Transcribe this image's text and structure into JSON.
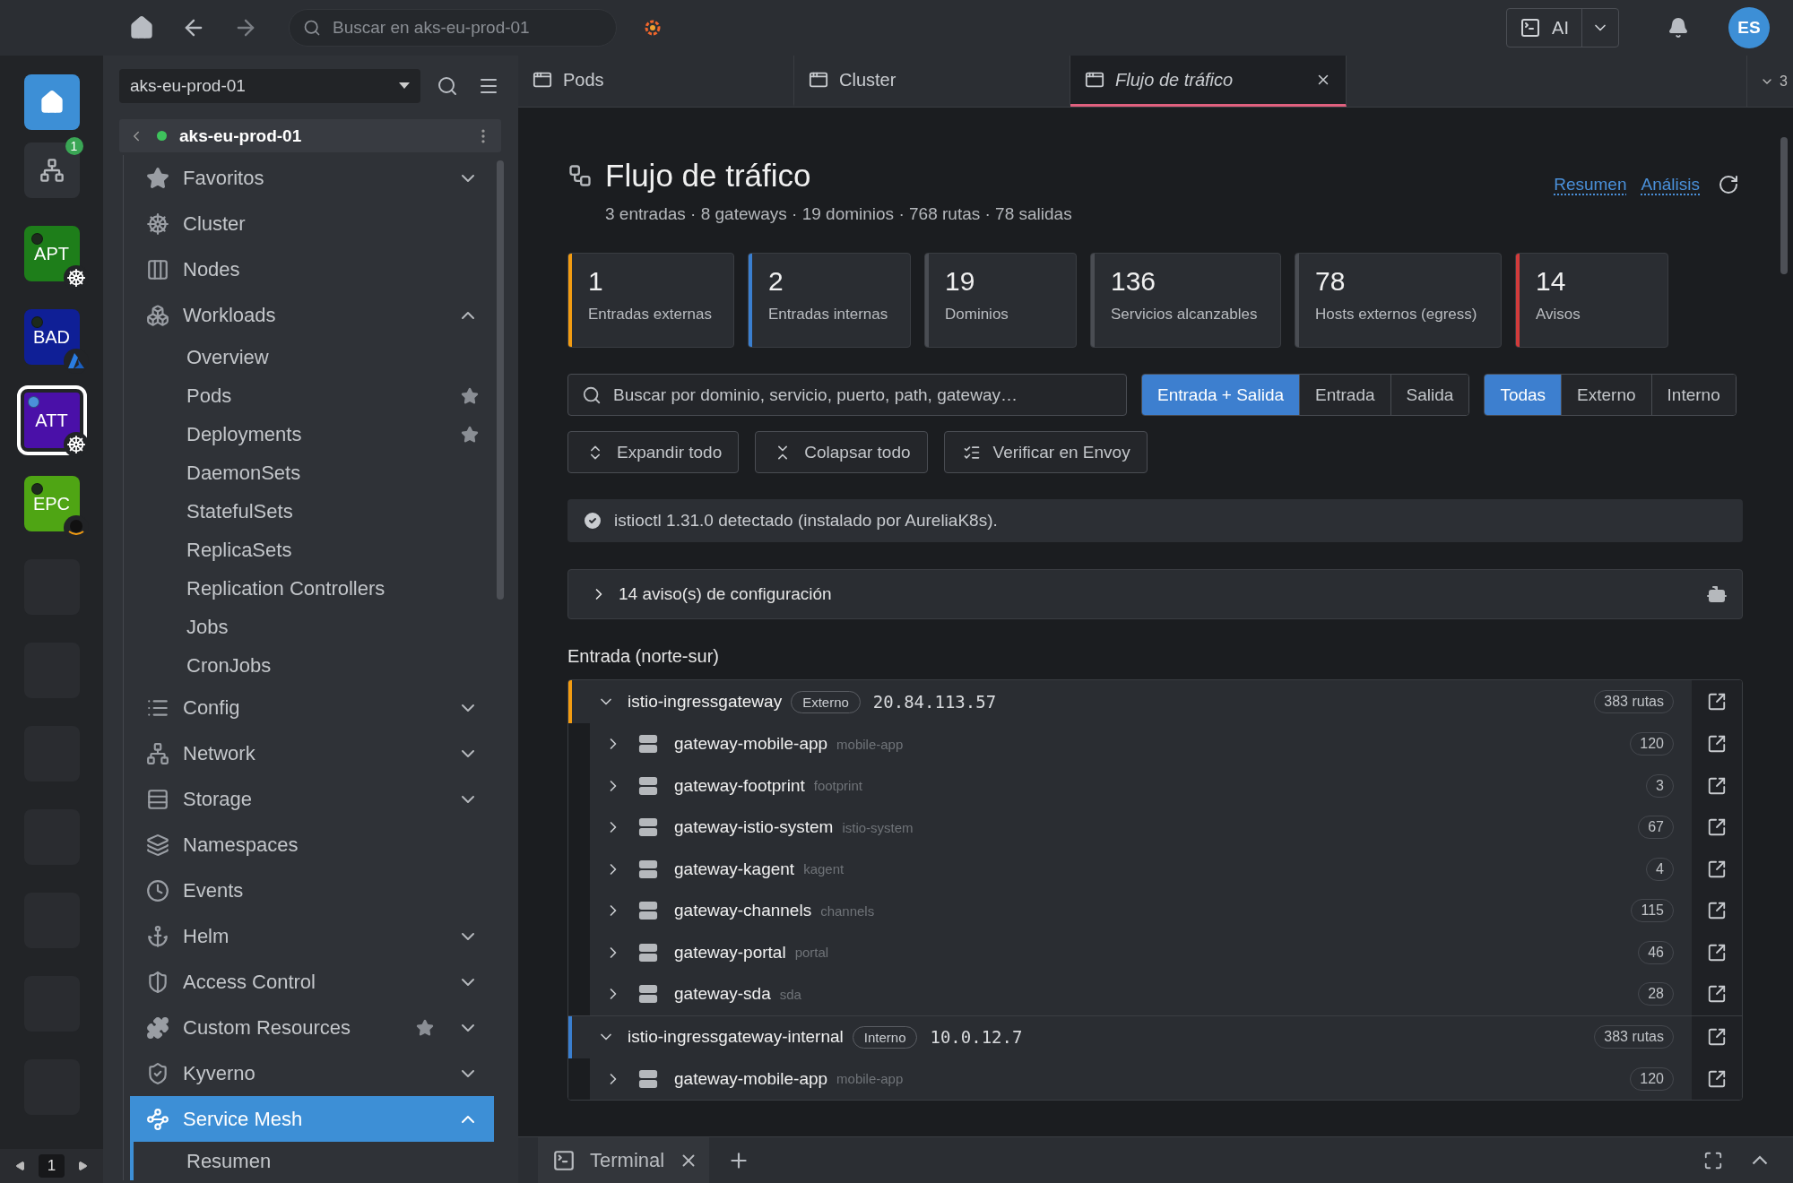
{
  "topbar": {
    "search_placeholder": "Buscar en aks-eu-prod-01",
    "ai_label": "AI",
    "avatar": "ES"
  },
  "rail": {
    "items": [
      {
        "kind": "home"
      },
      {
        "kind": "icon",
        "badge": "1"
      },
      {
        "kind": "cluster",
        "label": "APT",
        "color": "#1e7e1a",
        "overlay": {
          "kind": "wheel"
        },
        "selected": false,
        "connected": false
      },
      {
        "kind": "cluster",
        "label": "BAD",
        "color": "#0f1f96",
        "overlay": {
          "kind": "triangle"
        },
        "selected": false,
        "connected": false
      },
      {
        "kind": "cluster",
        "label": "ATT",
        "color": "#4a10a8",
        "overlay": {
          "kind": "wheel"
        },
        "selected": true,
        "connected": true
      },
      {
        "kind": "cluster",
        "label": "EPC",
        "color": "#4fa514",
        "overlay": {
          "kind": "hat"
        },
        "selected": false,
        "connected": false
      },
      {
        "kind": "empty"
      },
      {
        "kind": "empty"
      },
      {
        "kind": "empty"
      },
      {
        "kind": "empty"
      },
      {
        "kind": "empty"
      },
      {
        "kind": "empty"
      },
      {
        "kind": "empty"
      }
    ],
    "page": "1"
  },
  "sidebar": {
    "cluster_select": "aks-eu-prod-01",
    "context": "aks-eu-prod-01",
    "items": [
      {
        "label": "Favoritos",
        "starred": false,
        "expanded": false
      },
      {
        "label": "Cluster",
        "starred": false
      },
      {
        "label": "Nodes",
        "starred": false
      },
      {
        "label": "Workloads",
        "starred": false,
        "expanded": true,
        "selected": false,
        "children": [
          {
            "label": "Overview",
            "starred": false
          },
          {
            "label": "Pods",
            "starred": true
          },
          {
            "label": "Deployments",
            "starred": true
          },
          {
            "label": "DaemonSets",
            "starred": false
          },
          {
            "label": "StatefulSets",
            "starred": false
          },
          {
            "label": "ReplicaSets",
            "starred": false
          },
          {
            "label": "Replication Controllers",
            "starred": false
          },
          {
            "label": "Jobs",
            "starred": false
          },
          {
            "label": "CronJobs",
            "starred": false
          }
        ]
      },
      {
        "label": "Config",
        "starred": false,
        "expanded": false
      },
      {
        "label": "Network",
        "starred": false,
        "expanded": false
      },
      {
        "label": "Storage",
        "starred": false,
        "expanded": false
      },
      {
        "label": "Namespaces",
        "starred": false
      },
      {
        "label": "Events",
        "starred": false
      },
      {
        "label": "Helm",
        "starred": false,
        "expanded": false
      },
      {
        "label": "Access Control",
        "starred": false,
        "expanded": false
      },
      {
        "label": "Custom Resources",
        "starred": true,
        "expanded": false
      },
      {
        "label": "Kyverno",
        "starred": false,
        "expanded": false
      },
      {
        "label": "Service Mesh",
        "starred": false,
        "expanded": true,
        "selected": true,
        "children": [
          {
            "label": "Resumen",
            "starred": false
          }
        ]
      }
    ]
  },
  "main_tabs": {
    "tabs": [
      {
        "label": "Pods",
        "selected": false
      },
      {
        "label": "Cluster",
        "selected": false
      },
      {
        "label": "Flujo de tráfico",
        "selected": true
      }
    ],
    "overflow_count": "3"
  },
  "page": {
    "title": "Flujo de tráfico",
    "subtitle": "3 entradas · 8 gateways · 19 dominios · 768 rutas · 78 salidas",
    "links": [
      "Resumen",
      "Análisis"
    ],
    "stats": [
      {
        "value": "1",
        "label": "Entradas externas",
        "color": "#f39c12"
      },
      {
        "value": "2",
        "label": "Entradas internas",
        "color": "#3a7fd0"
      },
      {
        "value": "19",
        "label": "Dominios",
        "color": "#4a4d53"
      },
      {
        "value": "136",
        "label": "Servicios alcanzables",
        "color": "#4a4d53"
      },
      {
        "value": "78",
        "label": "Hosts externos (egress)",
        "color": "#4a4d53"
      },
      {
        "value": "14",
        "label": "Avisos",
        "color": "#d13b3b"
      }
    ],
    "search_placeholder": "Buscar por dominio, servicio, puerto, path, gateway…",
    "direction_filter": [
      {
        "label": "Entrada + Salida",
        "selected": true
      },
      {
        "label": "Entrada",
        "selected": false
      },
      {
        "label": "Salida",
        "selected": false
      }
    ],
    "scope_filter": [
      {
        "label": "Todas",
        "selected": true
      },
      {
        "label": "Externo",
        "selected": false
      },
      {
        "label": "Interno",
        "selected": false
      }
    ],
    "actions": [
      "Expandir todo",
      "Colapsar todo",
      "Verificar en Envoy"
    ],
    "info": "istioctl 1.31.0 detectado (instalado por AureliaK8s).",
    "warnings": {
      "label": "14 aviso(s) de configuración",
      "expanded": false
    },
    "section_title": "Entrada (norte-sur)",
    "gateways": [
      {
        "name": "istio-ingressgateway",
        "type_label": "Externo",
        "address": "20.84.113.57",
        "routes": "383 rutas",
        "color": "#f39c12",
        "expanded": true,
        "children": [
          {
            "name": "gateway-mobile-app",
            "namespace": "mobile-app",
            "count": "120",
            "expanded": false
          },
          {
            "name": "gateway-footprint",
            "namespace": "footprint",
            "count": "3",
            "expanded": false
          },
          {
            "name": "gateway-istio-system",
            "namespace": "istio-system",
            "count": "67",
            "expanded": false
          },
          {
            "name": "gateway-kagent",
            "namespace": "kagent",
            "count": "4",
            "expanded": false
          },
          {
            "name": "gateway-channels",
            "namespace": "channels",
            "count": "115",
            "expanded": false
          },
          {
            "name": "gateway-portal",
            "namespace": "portal",
            "count": "46",
            "expanded": false
          },
          {
            "name": "gateway-sda",
            "namespace": "sda",
            "count": "28",
            "expanded": false
          }
        ]
      },
      {
        "name": "istio-ingressgateway-internal",
        "type_label": "Interno",
        "address": "10.0.12.7",
        "routes": "383 rutas",
        "color": "#3a7fd0",
        "expanded": true,
        "children": [
          {
            "name": "gateway-mobile-app",
            "namespace": "mobile-app",
            "count": "120",
            "expanded": false
          }
        ]
      }
    ]
  },
  "bottom_panel": {
    "tabs": [
      {
        "label": "Terminal"
      }
    ]
  }
}
